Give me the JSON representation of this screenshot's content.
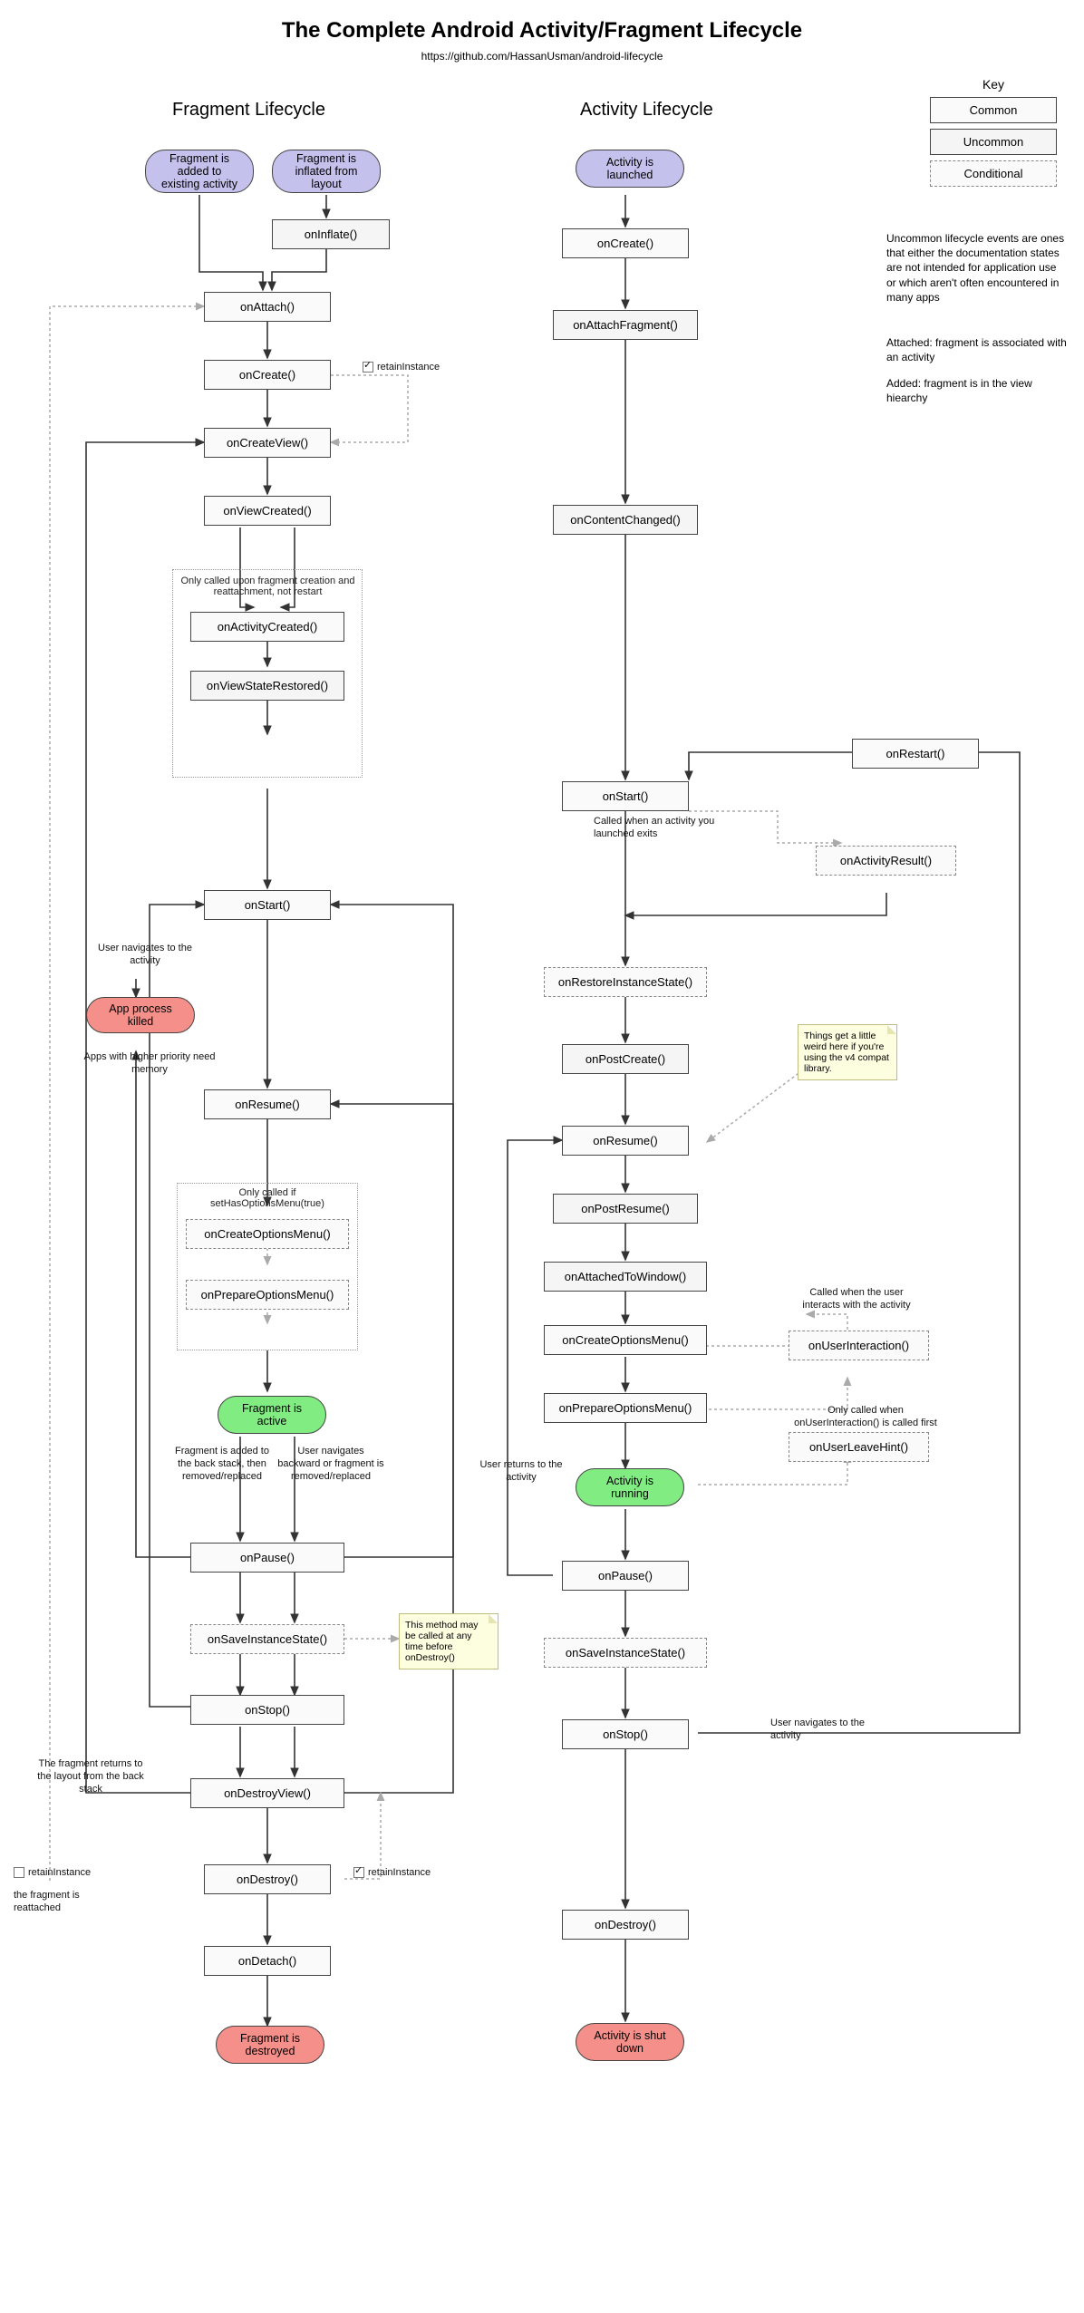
{
  "title": "The Complete Android Activity/Fragment Lifecycle",
  "url": "https://github.com/HassanUsman/android-lifecycle",
  "columns": {
    "fragment": "Fragment Lifecycle",
    "activity": "Activity Lifecycle"
  },
  "key": {
    "title": "Key",
    "common": "Common",
    "uncommon": "Uncommon",
    "conditional": "Conditional"
  },
  "sideNotes": {
    "uncommonDef": "Uncommon lifecycle events are ones that either the documentation states are not intended for application use or which aren't often encountered in many apps",
    "attached": "Attached: fragment is associated with an activity",
    "added": "Added: fragment is in the view hiearchy"
  },
  "fragment": {
    "starts": {
      "added": "Fragment is added to existing activity",
      "inflated": "Fragment is inflated from layout"
    },
    "nodes": {
      "onInflate": "onInflate()",
      "onAttach": "onAttach()",
      "onCreate": "onCreate()",
      "onCreateView": "onCreateView()",
      "onViewCreated": "onViewCreated()",
      "onActivityCreated": "onActivityCreated()",
      "onViewStateRestored": "onViewStateRestored()",
      "onStart": "onStart()",
      "onResume": "onResume()",
      "onCreateOptionsMenu": "onCreateOptionsMenu()",
      "onPrepareOptionsMenu": "onPrepareOptionsMenu()",
      "active": "Fragment is active",
      "onPause": "onPause()",
      "onSaveInstanceState": "onSaveInstanceState()",
      "onStop": "onStop()",
      "onDestroyView": "onDestroyView()",
      "onDestroy": "onDestroy()",
      "onDetach": "onDetach()",
      "destroyed": "Fragment is destroyed",
      "appKilled": "App process killed"
    },
    "labels": {
      "retainInstance": "retainInstance",
      "creationGroup": "Only called upon fragment creation and reattachment, not restart",
      "optionsGroup": "Only called if setHasOptionsMenu(true)",
      "userNav": "User navigates to the activity",
      "higherPriority": "Apps with higher priority need memory",
      "addedBack": "Fragment is added to the back stack, then removed/replaced",
      "userNavBack": "User navigates backward or fragment is removed/replaced",
      "returnsLayout": "The fragment returns to the layout from the back stack",
      "reattached": "the fragment is reattached",
      "saveNote": "This method may be called at any time before onDestroy()"
    }
  },
  "activity": {
    "starts": {
      "launched": "Activity is launched"
    },
    "nodes": {
      "onCreate": "onCreate()",
      "onAttachFragment": "onAttachFragment()",
      "onContentChanged": "onContentChanged()",
      "onStart": "onStart()",
      "onRestart": "onRestart()",
      "onActivityResult": "onActivityResult()",
      "onRestoreInstanceState": "onRestoreInstanceState()",
      "onPostCreate": "onPostCreate()",
      "onResume": "onResume()",
      "onPostResume": "onPostResume()",
      "onAttachedToWindow": "onAttachedToWindow()",
      "onCreateOptionsMenu": "onCreateOptionsMenu()",
      "onPrepareOptionsMenu": "onPrepareOptionsMenu()",
      "onUserInteraction": "onUserInteraction()",
      "onUserLeaveHint": "onUserLeaveHint()",
      "running": "Activity is running",
      "onPause": "onPause()",
      "onSaveInstanceState": "onSaveInstanceState()",
      "onStop": "onStop()",
      "onDestroy": "onDestroy()",
      "shutdown": "Activity is shut down"
    },
    "labels": {
      "calledExit": "Called when an activity you launched exits",
      "weirdNote": "Things get a little weird here if you're using the v4 compat library.",
      "userInteracts": "Called when the user interacts with the activity",
      "leaveHint": "Only called when onUserInteraction() is called first",
      "userReturns": "User returns to the activity",
      "userNavAway": "User navigates to the activity"
    }
  }
}
